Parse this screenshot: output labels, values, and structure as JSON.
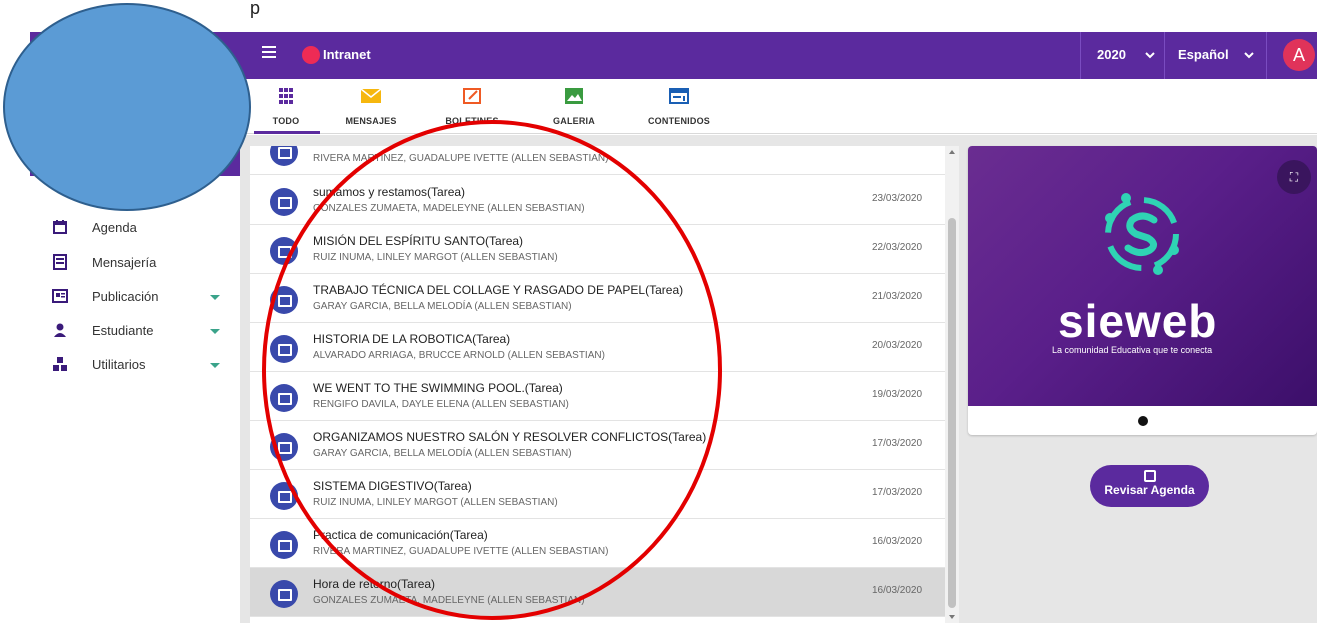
{
  "pre_text": "p",
  "topbar": {
    "app_title": "Intranet",
    "year": "2020",
    "language": "Español",
    "avatar_letter": "A",
    "brand_color": "#5b2a9e"
  },
  "tabs": [
    {
      "label": "TODO",
      "icon": "grid-icon"
    },
    {
      "label": "MENSAJES",
      "icon": "envelope-icon"
    },
    {
      "label": "BOLETINES",
      "icon": "edit-icon"
    },
    {
      "label": "GALERIA",
      "icon": "image-icon"
    },
    {
      "label": "CONTENIDOS",
      "icon": "content-icon"
    }
  ],
  "sidebar": {
    "items": [
      {
        "label": "",
        "icon": "home-icon"
      },
      {
        "label": "Agenda",
        "icon": "calendar-icon"
      },
      {
        "label": "Mensajería",
        "icon": "inbox-icon"
      },
      {
        "label": "Publicación",
        "icon": "newspaper-icon"
      },
      {
        "label": "Estudiante",
        "icon": "student-icon"
      },
      {
        "label": "Utilitarios",
        "icon": "tools-icon"
      }
    ]
  },
  "list": {
    "items": [
      {
        "title": "",
        "author": "RIVERA MARTINEZ, GUADALUPE IVETTE (ALLEN SEBASTIAN)",
        "date": ""
      },
      {
        "title": "sumamos y restamos(Tarea)",
        "author": "GONZALES ZUMAETA, MADELEYNE (ALLEN SEBASTIAN)",
        "date": "23/03/2020"
      },
      {
        "title": "MISIÓN DEL ESPÍRITU SANTO(Tarea)",
        "author": "RUIZ INUMA, LINLEY MARGOT (ALLEN SEBASTIAN)",
        "date": "22/03/2020"
      },
      {
        "title": "TRABAJO TÉCNICA DEL COLLAGE Y RASGADO DE PAPEL(Tarea)",
        "author": "GARAY GARCIA, BELLA MELODÍA (ALLEN SEBASTIAN)",
        "date": "21/03/2020"
      },
      {
        "title": "HISTORIA DE LA ROBOTICA(Tarea)",
        "author": "ALVARADO ARRIAGA, BRUCCE ARNOLD (ALLEN SEBASTIAN)",
        "date": "20/03/2020"
      },
      {
        "title": "WE WENT TO THE SWIMMING POOL.(Tarea)",
        "author": "RENGIFO DAVILA, DAYLE ELENA (ALLEN SEBASTIAN)",
        "date": "19/03/2020"
      },
      {
        "title": "ORGANIZAMOS NUESTRO SALÓN Y RESOLVER CONFLICTOS(Tarea)",
        "author": "GARAY GARCIA, BELLA MELODÍA (ALLEN SEBASTIAN)",
        "date": "17/03/2020"
      },
      {
        "title": "SISTEMA DIGESTIVO(Tarea)",
        "author": "RUIZ INUMA, LINLEY MARGOT (ALLEN SEBASTIAN)",
        "date": "17/03/2020"
      },
      {
        "title": "Practica de comunicación(Tarea)",
        "author": "RIVERA MARTINEZ, GUADALUPE IVETTE (ALLEN SEBASTIAN)",
        "date": "16/03/2020"
      },
      {
        "title": "Hora de retorno(Tarea)",
        "author": "GONZALES ZUMAETA, MADELEYNE (ALLEN SEBASTIAN)",
        "date": "16/03/2020"
      }
    ]
  },
  "banner": {
    "brand": "sieweb",
    "tagline": "La comunidad Educativa que te conecta"
  },
  "agenda_button": {
    "label": "Revisar Agenda"
  },
  "annotation_color": "#e30000",
  "redaction_color": "#5b9bd5"
}
